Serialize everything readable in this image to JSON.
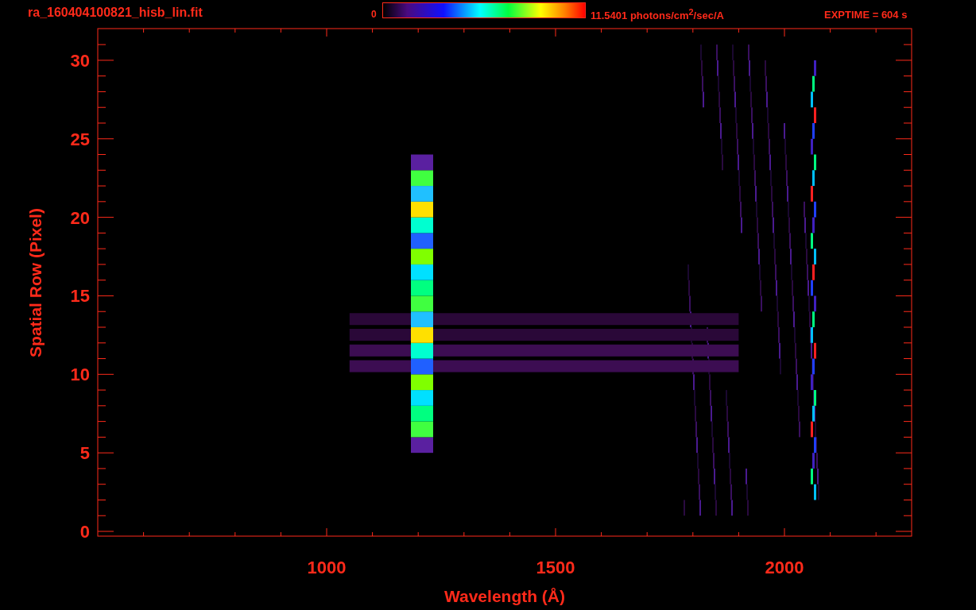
{
  "header": {
    "title": "ra_160404100821_hisb_lin.fit",
    "colorbar": {
      "min_label": "0",
      "max_label": "11.5401 photons/cm$^{2}$/sec/A"
    },
    "exptime": "EXPTIME = 604 s"
  },
  "plot": {
    "xlabel": "Wavelength (Å)",
    "ylabel": "Spatial Row (Pixel)",
    "xticks": [
      "1000",
      "1500",
      "2000"
    ],
    "yticks": [
      "30",
      "25",
      "20",
      "15",
      "10",
      "5",
      "0"
    ]
  }
}
